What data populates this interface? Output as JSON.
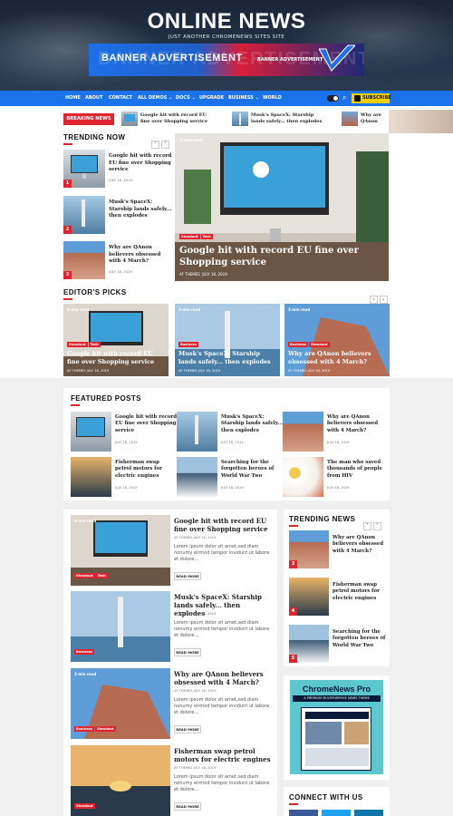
{
  "site": {
    "title": "ONLINE NEWS",
    "tagline": "JUST ANOTHER CHROMENEWS SITES SITE"
  },
  "banner": {
    "label": "BANNER ADVERTISEMENT",
    "ghost": "BANNER ADVERTISEMENT",
    "small": "BANNER ADVERTISEMENT"
  },
  "nav": {
    "items": [
      "HOME",
      "ABOUT",
      "CONTACT",
      "ALL DEMOS ⌄",
      "DOCS ⌄",
      "UPGRADE",
      "BUSINESS ⌄",
      "WORLD"
    ],
    "subscribe": "SUBSCRIBE"
  },
  "breaking": {
    "label": "BREAKING NEWS",
    "items": [
      "Google hit with record EU fine over Shopping service",
      "Musk's SpaceX: Starship lands safely... then explodes",
      "Why are QAnon"
    ]
  },
  "trending": {
    "title": "TRENDING NOW",
    "items": [
      {
        "title": "Google hit with record EU fine over Shopping service",
        "date": "JULY 18, 2019",
        "num": "1"
      },
      {
        "title": "Musk's SpaceX: Starship lands safely... then explodes",
        "date": "JULY 18, 2019",
        "num": "2"
      },
      {
        "title": "Why are QAnon believers obsessed with 4 March?",
        "date": "JULY 18, 2019",
        "num": "3"
      }
    ]
  },
  "hero": {
    "read": "4 min read",
    "tags": [
      "Standout",
      "Tech"
    ],
    "title": "Google hit with record EU fine over Shopping service",
    "author": "AF THEMES",
    "date": "JULY 18, 2019"
  },
  "editors": {
    "title": "EDITOR'S PICKS",
    "items": [
      {
        "read": "4 min read",
        "tags": [
          "Standout",
          "Tech"
        ],
        "title": "Google hit with record EU fine over Shopping service",
        "author": "AF THEMES",
        "date": "JULY 18, 2019"
      },
      {
        "read": "3 min read",
        "tags": [
          "Business"
        ],
        "title": "Musk's SpaceX: Starship lands safely... then explodes",
        "author": "AF THEMES",
        "date": "JULY 18, 2019"
      },
      {
        "read": "3 min read",
        "tags": [
          "Business",
          "Standout"
        ],
        "title": "Why are QAnon believers obsessed with 4 March?",
        "author": "AF THEMES",
        "date": "JULY 18, 2019"
      }
    ]
  },
  "featured": {
    "title": "FEATURED POSTS",
    "items": [
      {
        "title": "Google hit with record EU fine over Shopping service",
        "date": "JULY 18, 2019"
      },
      {
        "title": "Musk's SpaceX: Starship lands safely... then explodes",
        "date": "JULY 18, 2019"
      },
      {
        "title": "Why are QAnon believers obsessed with 4 March?",
        "date": "JULY 18, 2019"
      },
      {
        "title": "Fisherman swap petrol motors for electric engines",
        "date": "JULY 18, 2019"
      },
      {
        "title": "Searching for the forgotten heroes of World War Two",
        "date": "JULY 18, 2019"
      },
      {
        "title": "The man who saved thousands of people from HIV",
        "date": "JULY 18, 2019"
      }
    ]
  },
  "list": {
    "items": [
      {
        "read": "4 min read",
        "tags": [
          "Standout",
          "Tech"
        ],
        "title": "Google hit with record EU fine over Shopping service",
        "author": "AF THEMES",
        "date": "JULY 18, 2019",
        "excerpt": "Lorem ipsum dolor sit amet,sed diam nonumy eirmod tempor invidunt ut labore et dolore...",
        "more": "READ MORE"
      },
      {
        "read": "",
        "tags": [
          "Business"
        ],
        "title": "Musk's SpaceX: Starship lands safely... then explodes",
        "author": "AF THEMES",
        "date": "JULY 18, 2019",
        "excerpt": "Lorem ipsum dolor sit amet,sed diam nonumy eirmod tempor invidunt ut labore et dolore...",
        "more": "READ MORE"
      },
      {
        "read": "3 min read",
        "tags": [
          "Business",
          "Standout"
        ],
        "title": "Why are QAnon believers obsessed with 4 March?",
        "author": "AF THEMES",
        "date": "JULY 18, 2019",
        "excerpt": "Lorem ipsum dolor sit amet,sed diam nonumy eirmod tempor invidunt ut labore et dolore...",
        "more": "READ MORE"
      },
      {
        "read": "",
        "tags": [
          "Standout"
        ],
        "title": "Fisherman swap petrol motors for electric engines",
        "author": "AF THEMES",
        "date": "JULY 18, 2019",
        "excerpt": "Lorem ipsum dolor sit amet,sed diam nonumy eirmod tempor invidunt ut labore et dolore...",
        "more": "READ MORE"
      }
    ]
  },
  "side_trending": {
    "title": "TRENDING NEWS",
    "items": [
      {
        "title": "Why are QAnon believers obsessed with 4 March?",
        "num": "3"
      },
      {
        "title": "Fisherman swap petrol motors for electric engines",
        "num": "4"
      },
      {
        "title": "Searching for the forgotten heroes of World War Two",
        "num": "5"
      }
    ]
  },
  "ad": {
    "title": "ChromeNews Pro",
    "subtitle": "A PREMIUM MULTIPURPOSE NEWS THEME"
  },
  "connect": {
    "title": "CONNECT WITH US"
  },
  "colors": {
    "accent": "#e0242f",
    "nav": "#1a73e8",
    "subscribe": "#f5d000"
  }
}
